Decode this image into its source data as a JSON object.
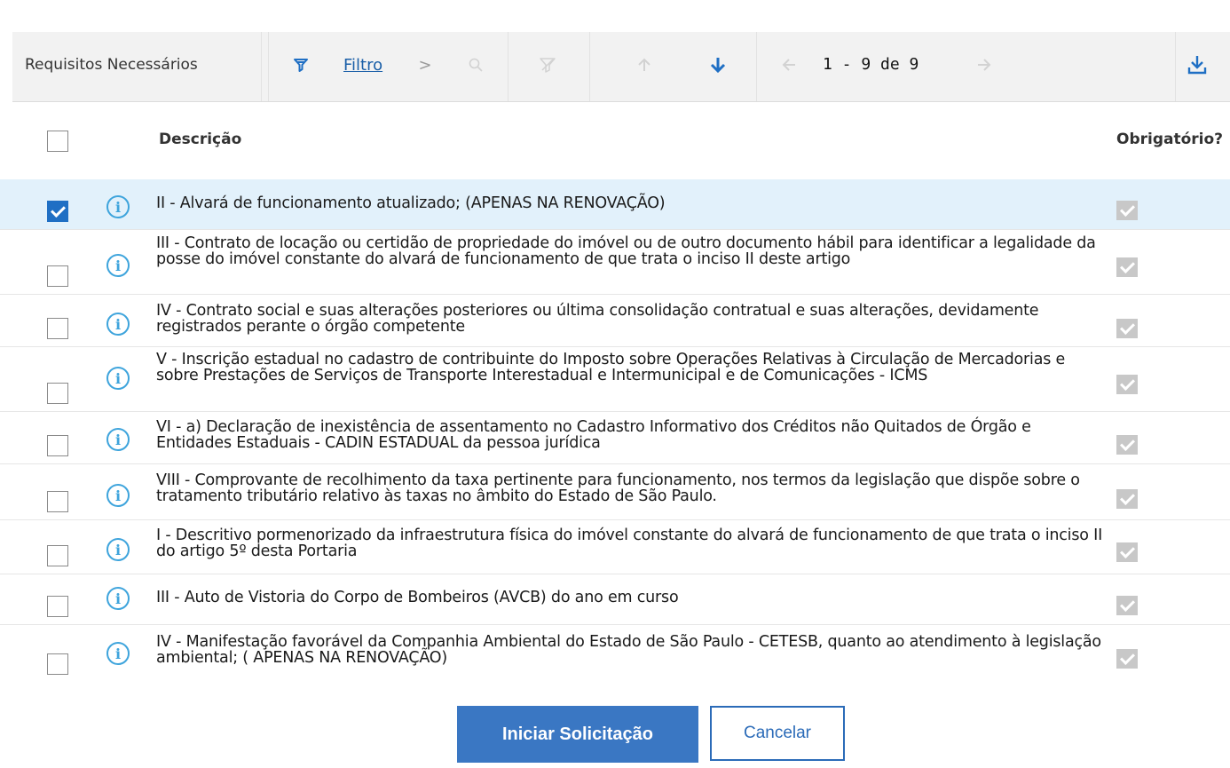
{
  "toolbar": {
    "title": "Requisitos Necessários",
    "filter_label": "Filtro",
    "arrow_glyph": ">",
    "pager_text": "1 - 9 de 9"
  },
  "table": {
    "headers": {
      "description": "Descrição",
      "mandatory": "Obrigatório?"
    },
    "rows": [
      {
        "selected": true,
        "mandatory": true,
        "description": "II - Alvará de funcionamento atualizado; (APENAS NA RENOVAÇÃO)"
      },
      {
        "selected": false,
        "mandatory": true,
        "description": "III - Contrato de locação ou certidão de propriedade do imóvel ou de outro documento hábil para identificar a legalidade da posse do imóvel constante do alvará de funcionamento de que trata o inciso II deste artigo"
      },
      {
        "selected": false,
        "mandatory": true,
        "description": "IV - Contrato social e suas alterações posteriores ou última consolidação contratual e suas alterações, devidamente registrados perante o órgão competente"
      },
      {
        "selected": false,
        "mandatory": true,
        "description": "V - Inscrição estadual no cadastro de contribuinte do Imposto sobre Operações Relativas à Circulação de Mercadorias e sobre Prestações de Serviços de Transporte Interestadual e Intermunicipal e de Comunicações - ICMS"
      },
      {
        "selected": false,
        "mandatory": true,
        "description": "VI - a) Declaração de inexistência de assentamento no Cadastro Informativo dos Créditos não Quitados de Órgão e Entidades Estaduais - CADIN ESTADUAL da pessoa jurídica"
      },
      {
        "selected": false,
        "mandatory": true,
        "description": "VIII - Comprovante de recolhimento da taxa pertinente para funcionamento, nos termos da legislação que dispõe sobre o tratamento tributário relativo às taxas no âmbito do Estado de São Paulo."
      },
      {
        "selected": false,
        "mandatory": true,
        "description": "I - Descritivo pormenorizado da infraestrutura física do imóvel constante do alvará de funcionamento de que trata o inciso II do artigo 5º desta Portaria"
      },
      {
        "selected": false,
        "mandatory": true,
        "description": "III - Auto de Vistoria do Corpo de Bombeiros (AVCB) do ano em curso"
      },
      {
        "selected": false,
        "mandatory": true,
        "description": "IV - Manifestação favorável da Companhia Ambiental do Estado de São Paulo - CETESB, quanto ao atendimento à legislação ambiental; ( APENAS NA RENOVAÇÃO)"
      }
    ]
  },
  "actions": {
    "start_label": "Iniciar Solicitação",
    "cancel_label": "Cancelar"
  },
  "icons": {
    "filter": "filter-icon",
    "search": "search-icon",
    "clear_filter": "clear-filter-icon",
    "sort_up": "arrow-up-icon",
    "sort_down": "arrow-down-icon",
    "prev": "arrow-left-icon",
    "next": "arrow-right-icon",
    "download": "download-icon",
    "info": "info-icon"
  },
  "colors": {
    "accent": "#3a77c3",
    "link": "#1a5fa8",
    "selected_row": "#e2f1fb",
    "info": "#3ea4dc"
  }
}
